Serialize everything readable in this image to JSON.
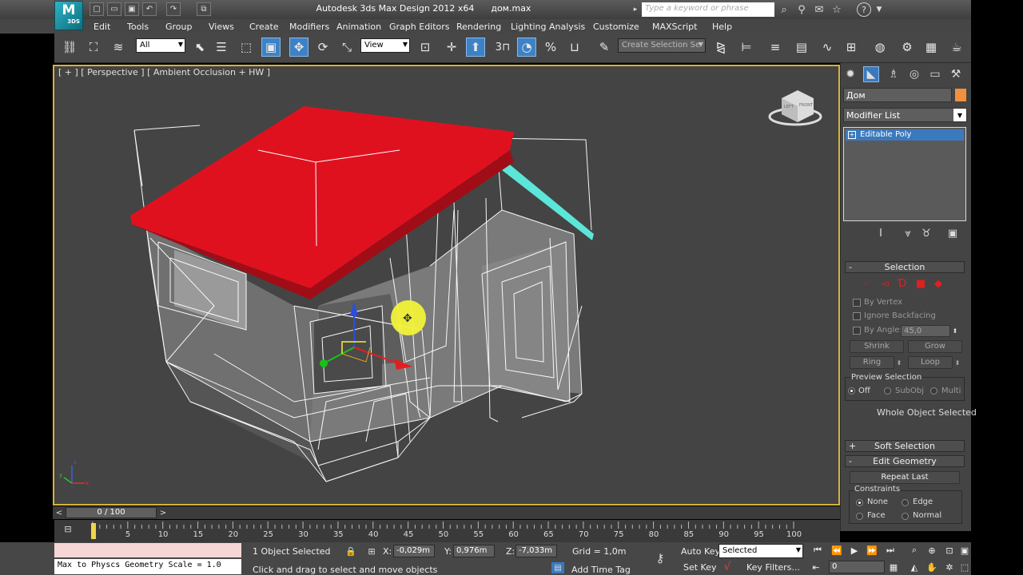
{
  "window": {
    "title": "Autodesk 3ds Max Design 2012 x64",
    "filename": "дом.max",
    "logo": "3DS",
    "logo_main": "M",
    "search_placeholder": "Type a keyword or phrase"
  },
  "menu": [
    "Edit",
    "Tools",
    "Group",
    "Views",
    "Create",
    "Modifiers",
    "Animation",
    "Graph Editors",
    "Rendering",
    "Lighting Analysis",
    "Customize",
    "MAXScript",
    "Help"
  ],
  "toolbar": {
    "selection_filter": "All",
    "ref_coord": "View",
    "snap_label": "3",
    "named_selection": "Create Selection Se"
  },
  "viewport": {
    "label": "[ + ] [ Perspective ] [ Ambient Occlusion + HW ]",
    "viewcube_left": "LEFT",
    "viewcube_front": "FRONT",
    "axis_x": "x",
    "axis_y": "y",
    "axis_z": "z",
    "roof_color": "#e0111f",
    "frame_color": "#d7b23a",
    "wire_color": "#ffffff",
    "gable_color": "#5ce6d8"
  },
  "command_panel": {
    "object_name": "Дом",
    "object_color": "#f0913f",
    "modifier_list": "Modifier List",
    "stack_item": "Editable Poly",
    "selection": {
      "title": "Selection",
      "by_vertex": "By Vertex",
      "ignore_backfacing": "Ignore Backfacing",
      "by_angle": "By Angle:",
      "angle_value": "45,0",
      "shrink": "Shrink",
      "grow": "Grow",
      "ring": "Ring",
      "loop": "Loop",
      "preview_title": "Preview Selection",
      "preview_off": "Off",
      "preview_subobj": "SubObj",
      "preview_multi": "Multi",
      "status": "Whole Object Selected"
    },
    "soft_selection": "Soft Selection",
    "edit_geometry": {
      "title": "Edit Geometry",
      "repeat_last": "Repeat Last",
      "constraints": "Constraints",
      "none": "None",
      "edge": "Edge",
      "face": "Face",
      "normal": "Normal"
    }
  },
  "timeline": {
    "frame": "0 / 100",
    "prev": "<",
    "next": ">",
    "ticks": [
      "5",
      "10",
      "15",
      "20",
      "25",
      "30",
      "35",
      "40",
      "45",
      "50",
      "55",
      "60",
      "65",
      "70",
      "75",
      "80",
      "85",
      "90",
      "95",
      "100"
    ]
  },
  "status": {
    "maxscript_output": "Max to Physcs Geometry Scale = 1.0",
    "selection_count": "1 Object Selected",
    "prompt": "Click and drag to select and move objects",
    "x_label": "X:",
    "x_value": "-0,029m",
    "y_label": "Y:",
    "y_value": "0,976m",
    "z_label": "Z:",
    "z_value": "-7,033m",
    "grid": "Grid = 1,0m",
    "add_time_tag": "Add Time Tag",
    "auto_key": "Auto Key",
    "set_key": "Set Key",
    "key_mode": "Selected",
    "key_filters": "Key Filters...",
    "current_frame": "0"
  }
}
